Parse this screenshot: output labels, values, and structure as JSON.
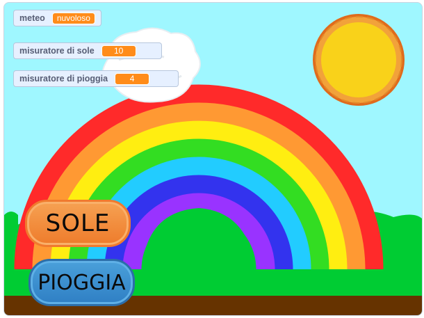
{
  "monitors": {
    "weather": {
      "label": "meteo",
      "value": "nuvoloso"
    },
    "sun_meter": {
      "label": "misuratore di sole",
      "value": "10"
    },
    "rain_meter": {
      "label": "misuratore di pioggia",
      "value": "4"
    }
  },
  "buttons": {
    "sun": "SOLE",
    "rain": "PIOGGIA"
  },
  "colors": {
    "sky": "#9ff7ff",
    "grass": "#00cc33",
    "ground": "#663300",
    "monitor_value": "#ff8c1a",
    "rainbow": [
      "#ff2a2a",
      "#ff9933",
      "#ffee11",
      "#33dd22",
      "#22ccff",
      "#3333ee",
      "#9933ff"
    ]
  },
  "icons": {
    "sun": "sun-icon",
    "cloud": "cloud-icon"
  }
}
